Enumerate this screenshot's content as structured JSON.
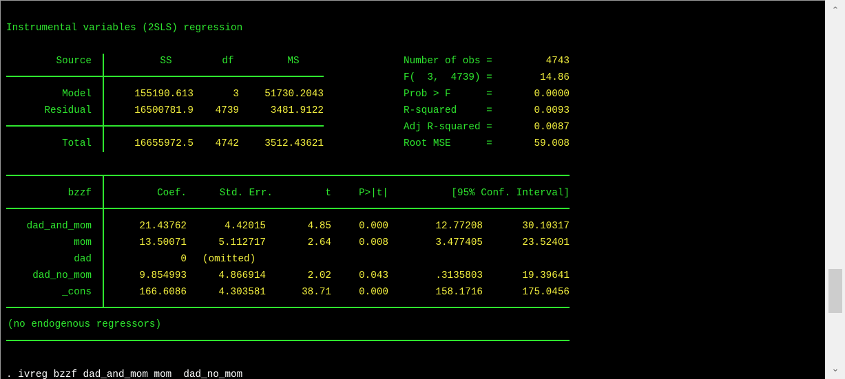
{
  "title": "Instrumental variables (2SLS) regression",
  "anova": {
    "headers": [
      "Source",
      "SS",
      "df",
      "MS"
    ],
    "rows": [
      {
        "source": "Model",
        "ss": "155190.613",
        "df": "3",
        "ms": "51730.2043"
      },
      {
        "source": "Residual",
        "ss": "16500781.9",
        "df": "4739",
        "ms": "3481.9122"
      },
      {
        "source": "Total",
        "ss": "16655972.5",
        "df": "4742",
        "ms": "3512.43621"
      }
    ]
  },
  "stats": [
    {
      "label": "Number of obs =",
      "value": "4743"
    },
    {
      "label": "F(  3,  4739) =",
      "value": "14.86"
    },
    {
      "label": "Prob > F      =",
      "value": "0.0000"
    },
    {
      "label": "R-squared     =",
      "value": "0.0093"
    },
    {
      "label": "Adj R-squared =",
      "value": "0.0087"
    },
    {
      "label": "Root MSE      =",
      "value": "59.008"
    }
  ],
  "coef": {
    "headers": [
      "bzzf",
      "Coef.",
      "Std. Err.",
      "t",
      "P>|t|",
      "[95% Conf. Interval]"
    ],
    "rows": [
      {
        "var": "dad_and_mom",
        "coef": "21.43762",
        "se": "4.42015",
        "t": "4.85",
        "p": "0.000",
        "lo": "12.77208",
        "hi": "30.10317"
      },
      {
        "var": "mom",
        "coef": "13.50071",
        "se": "5.112717",
        "t": "2.64",
        "p": "0.008",
        "lo": "3.477405",
        "hi": "23.52401"
      },
      {
        "var": "dad",
        "coef": "0",
        "se": "(omitted)",
        "t": "",
        "p": "",
        "lo": "",
        "hi": ""
      },
      {
        "var": "dad_no_mom",
        "coef": "9.854993",
        "se": "4.866914",
        "t": "2.02",
        "p": "0.043",
        "lo": ".3135803",
        "hi": "19.39641"
      },
      {
        "var": "_cons",
        "coef": "166.6086",
        "se": "4.303581",
        "t": "38.71",
        "p": "0.000",
        "lo": "158.1716",
        "hi": "175.0456"
      }
    ]
  },
  "note": "(no endogenous regressors)",
  "command": ". ivreg bzzf dad_and_mom mom  dad_no_mom",
  "scroll": {
    "up_icon": "chevron-up-icon",
    "down_icon": "chevron-down-icon"
  },
  "colors": {
    "background": "#000000",
    "text_green": "#2ee62e",
    "text_yellow": "#f2ef3e"
  }
}
